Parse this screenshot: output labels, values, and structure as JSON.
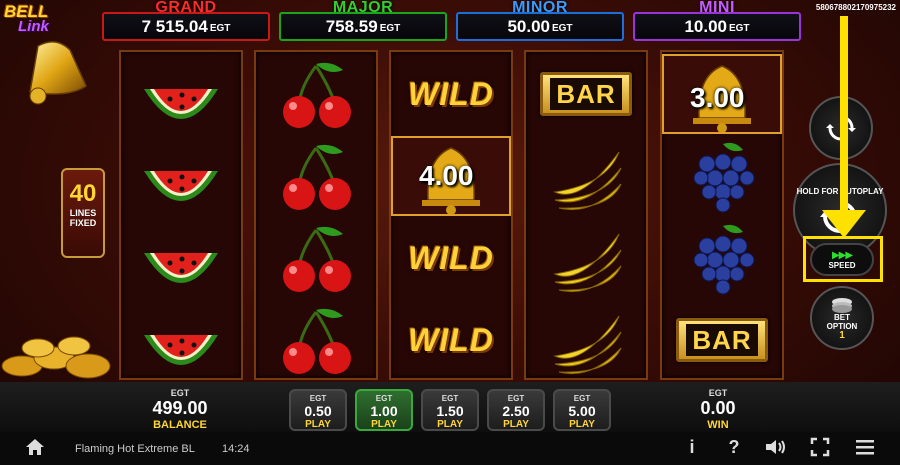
{
  "logo": {
    "line1": "BELL",
    "line2": "Link"
  },
  "session_id": "580678802170975232",
  "jackpots": [
    {
      "name": "GRAND",
      "value": "7 515.04",
      "currency": "EGT"
    },
    {
      "name": "MAJOR",
      "value": "758.59",
      "currency": "EGT"
    },
    {
      "name": "MINOR",
      "value": "50.00",
      "currency": "EGT"
    },
    {
      "name": "MINI",
      "value": "10.00",
      "currency": "EGT"
    }
  ],
  "lines": {
    "count": "40",
    "label1": "LINES",
    "label2": "FIXED"
  },
  "reels": [
    [
      "watermelon",
      "watermelon",
      "watermelon",
      "watermelon"
    ],
    [
      "cherries",
      "cherries",
      "cherries",
      "cherries"
    ],
    [
      "wild",
      "bell",
      "wild",
      "wild"
    ],
    [
      "bar",
      "bananas",
      "bananas",
      "bananas"
    ],
    [
      "bell",
      "grapes",
      "grapes",
      "bar"
    ]
  ],
  "symbol_text": {
    "wild": "WILD",
    "bar": "BAR"
  },
  "bell_values": {
    "reel3": "4.00",
    "reel5": "3.00"
  },
  "controls": {
    "hold_label": "HOLD FOR AUTOPLAY",
    "speed_label": "SPEED",
    "bet_option_label1": "BET",
    "bet_option_label2": "OPTION",
    "bet_option_value": "1"
  },
  "balance": {
    "currency": "EGT",
    "value": "499.00",
    "label": "BALANCE"
  },
  "bets": [
    {
      "currency": "EGT",
      "value": "0.50",
      "action": "PLAY",
      "active": false
    },
    {
      "currency": "EGT",
      "value": "1.00",
      "action": "PLAY",
      "active": true
    },
    {
      "currency": "EGT",
      "value": "1.50",
      "action": "PLAY",
      "active": false
    },
    {
      "currency": "EGT",
      "value": "2.50",
      "action": "PLAY",
      "active": false
    },
    {
      "currency": "EGT",
      "value": "5.00",
      "action": "PLAY",
      "active": false
    }
  ],
  "win": {
    "currency": "EGT",
    "value": "0.00",
    "label": "WIN"
  },
  "footer": {
    "game_name": "Flaming Hot Extreme BL",
    "time": "14:24"
  },
  "icons": [
    "home-icon",
    "info-icon",
    "help-icon",
    "sound-icon",
    "fullscreen-icon",
    "menu-icon"
  ],
  "colors": {
    "grand": "#ff2a2a",
    "major": "#2fd12f",
    "minor": "#3a9bff",
    "mini": "#c45cff",
    "accent": "#ffe100",
    "active_bet": "#3aa83a"
  }
}
